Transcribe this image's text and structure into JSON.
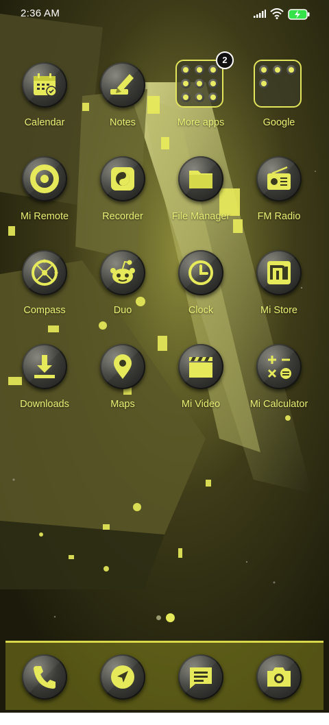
{
  "status_bar": {
    "time": "2:36 AM"
  },
  "home": {
    "apps": [
      {
        "label": "Calendar"
      },
      {
        "label": "Notes"
      },
      {
        "label": "More apps",
        "badge": "2"
      },
      {
        "label": "Google"
      },
      {
        "label": "Mi Remote"
      },
      {
        "label": "Recorder"
      },
      {
        "label": "File Manager"
      },
      {
        "label": "FM Radio"
      },
      {
        "label": "Compass"
      },
      {
        "label": "Duo"
      },
      {
        "label": "Clock"
      },
      {
        "label": "Mi Store"
      },
      {
        "label": "Downloads"
      },
      {
        "label": "Maps"
      },
      {
        "label": "Mi Video"
      },
      {
        "label": "Mi Calculator"
      }
    ]
  },
  "dock": {
    "apps": [
      {
        "icon": "phone-icon"
      },
      {
        "icon": "navigation-icon"
      },
      {
        "icon": "messages-icon"
      },
      {
        "icon": "camera-icon"
      }
    ]
  },
  "colors": {
    "accent": "#e6ea5a",
    "label": "#eaf075"
  }
}
